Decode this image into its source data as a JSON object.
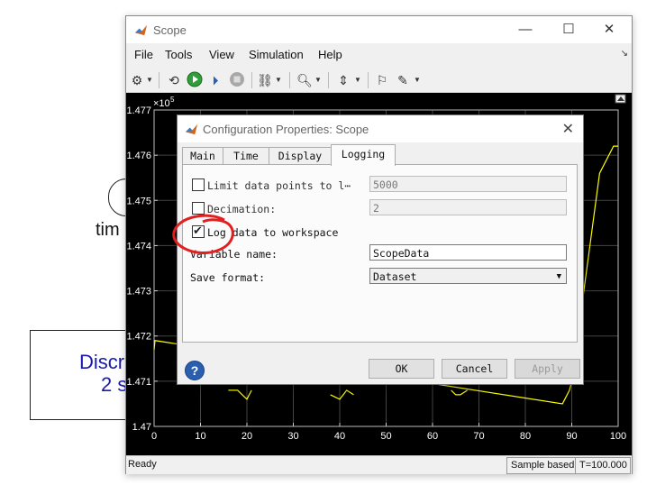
{
  "background": {
    "block1_label": "tim",
    "block2_line1": "Discr",
    "block2_line2": "2 s"
  },
  "window": {
    "title": "Scope",
    "controls": [
      "—",
      "☐",
      "✕"
    ]
  },
  "menu": {
    "items": [
      "File",
      "Tools",
      "View",
      "Simulation",
      "Help"
    ]
  },
  "plot": {
    "exponent_label": "×10",
    "exponent_power": "5",
    "y_ticks": [
      "1.477",
      "1.476",
      "1.475",
      "1.474",
      "1.473",
      "1.472",
      "1.471",
      "1.47"
    ],
    "x_ticks": [
      "0",
      "10",
      "20",
      "30",
      "40",
      "50",
      "60",
      "70",
      "80",
      "90",
      "100"
    ],
    "trace_color": "#ffff00",
    "background_color": "#000000",
    "grid_color": "#444444"
  },
  "chart_data": {
    "type": "line",
    "xlim": [
      0,
      100
    ],
    "ylim": [
      147000,
      147700
    ],
    "grid": true,
    "series": [
      {
        "x": [
          0,
          0.2,
          88,
          89.5,
          90,
          96,
          99,
          100
        ],
        "y": [
          147170,
          147190,
          147050,
          147080,
          147100,
          147560,
          147620,
          147620
        ]
      }
    ],
    "dips": [
      {
        "x": [
          16,
          18,
          20,
          21
        ],
        "y": [
          147080,
          147080,
          147060,
          147080
        ]
      },
      {
        "x": [
          38,
          40,
          41.5,
          43
        ],
        "y": [
          147070,
          147060,
          147080,
          147070
        ]
      },
      {
        "x": [
          64,
          65,
          66,
          67.5
        ],
        "y": [
          147080,
          147070,
          147070,
          147080
        ]
      }
    ]
  },
  "status": {
    "ready": "Ready",
    "mode": "Sample based",
    "time": "T=100.000"
  },
  "dialog": {
    "title": "Configuration Properties: Scope",
    "close": "✕",
    "tabs": [
      "Main",
      "Time",
      "Display",
      "Logging"
    ],
    "active_tab": "Logging",
    "limit_label": "Limit data points to l⋯",
    "limit_checked": false,
    "limit_value": "5000",
    "decimation_label": "Decimation:",
    "decimation_checked": false,
    "decimation_value": "2",
    "log_label": "Log data to workspace",
    "log_checked": true,
    "variable_label": "Variable name:",
    "variable_value": "ScopeData",
    "format_label": "Save format:",
    "format_value": "Dataset",
    "ok": "OK",
    "cancel": "Cancel",
    "apply": "Apply",
    "help": "?"
  },
  "annotation": {
    "color": "#e02020"
  }
}
